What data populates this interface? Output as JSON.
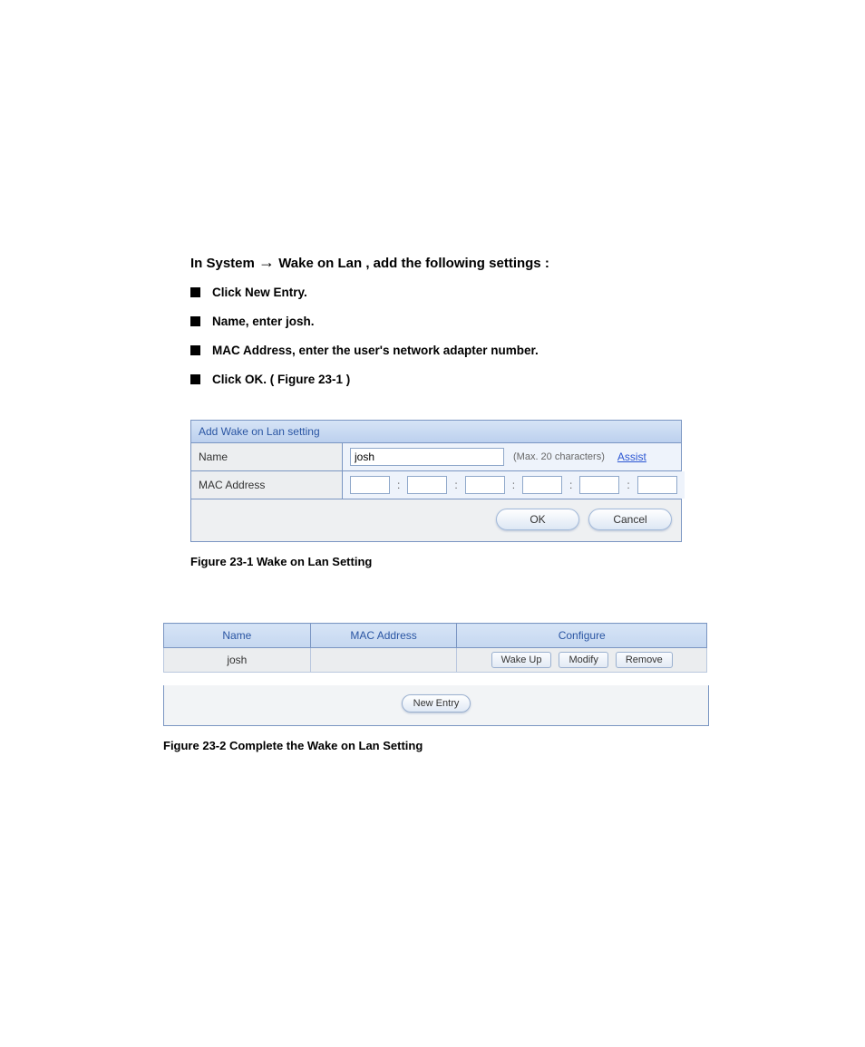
{
  "heading_prefix": "In System ",
  "heading_suffix": " Wake on Lan , add the following settings :",
  "steps": [
    {
      "text": "Click New Entry."
    },
    {
      "label": "Name",
      "text": ", enter josh."
    },
    {
      "label": "MAC Address",
      "text": ", enter the user's network adapter number."
    },
    {
      "label_prefix": "Click ",
      "label": "OK",
      "text": ". ( Figure 23-1 )"
    }
  ],
  "panel": {
    "title": "Add Wake on Lan setting",
    "rows": {
      "name": {
        "label": "Name",
        "value": "josh",
        "hint": "(Max. 20 characters)",
        "assist": "Assist"
      },
      "mac": {
        "label": "MAC Address"
      }
    },
    "buttons": {
      "ok": "OK",
      "cancel": "Cancel"
    }
  },
  "caption1": "Figure 23-1 Wake on Lan Setting",
  "table": {
    "headers": {
      "name": "Name",
      "mac": "MAC Address",
      "configure": "Configure"
    },
    "row": {
      "name": "josh",
      "mac": "",
      "actions": {
        "wake": "Wake Up",
        "modify": "Modify",
        "remove": "Remove"
      }
    },
    "new_entry": "New Entry"
  },
  "caption2": "Figure 23-2 Complete the Wake on Lan Setting"
}
